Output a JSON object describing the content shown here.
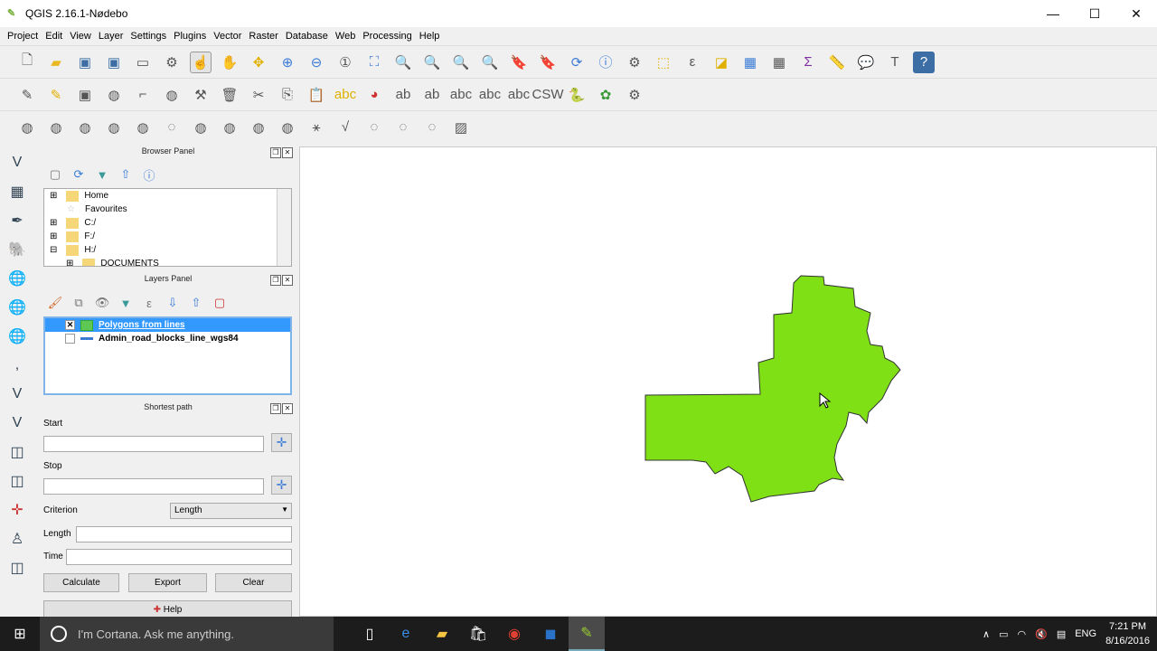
{
  "window": {
    "title": "QGIS 2.16.1-Nødebo",
    "minimize": "—",
    "maximize": "☐",
    "close": "✕"
  },
  "menu": [
    "Project",
    "Edit",
    "View",
    "Layer",
    "Settings",
    "Plugins",
    "Vector",
    "Raster",
    "Database",
    "Web",
    "Processing",
    "Help"
  ],
  "browser_panel": {
    "title": "Browser Panel",
    "items": [
      {
        "label": "Home",
        "exp": "⊞"
      },
      {
        "label": "Favourites",
        "exp": ""
      },
      {
        "label": "C:/",
        "exp": "⊞"
      },
      {
        "label": "F:/",
        "exp": "⊞"
      },
      {
        "label": "H:/",
        "exp": "⊟"
      },
      {
        "label": "DOCUMENTS",
        "exp": "⊞"
      }
    ]
  },
  "layers_panel": {
    "title": "Layers Panel",
    "layers": [
      {
        "name": "Polygons from lines",
        "checked": "✕",
        "color": "#5fc754"
      },
      {
        "name": "Admin_road_blocks_line_wgs84",
        "checked": "",
        "color": "#3a7bd5"
      }
    ]
  },
  "shortest_path": {
    "title": "Shortest path",
    "start_label": "Start",
    "stop_label": "Stop",
    "criterion_label": "Criterion",
    "criterion_value": "Length",
    "length_label": "Length",
    "time_label": "Time",
    "calculate": "Calculate",
    "export": "Export",
    "clear": "Clear",
    "help": "Help"
  },
  "map": {
    "polygon_fill": "#7fe016"
  },
  "taskbar": {
    "cortana": "I'm Cortana. Ask me anything.",
    "lang": "ENG",
    "time": "7:21 PM",
    "date": "8/16/2016"
  }
}
